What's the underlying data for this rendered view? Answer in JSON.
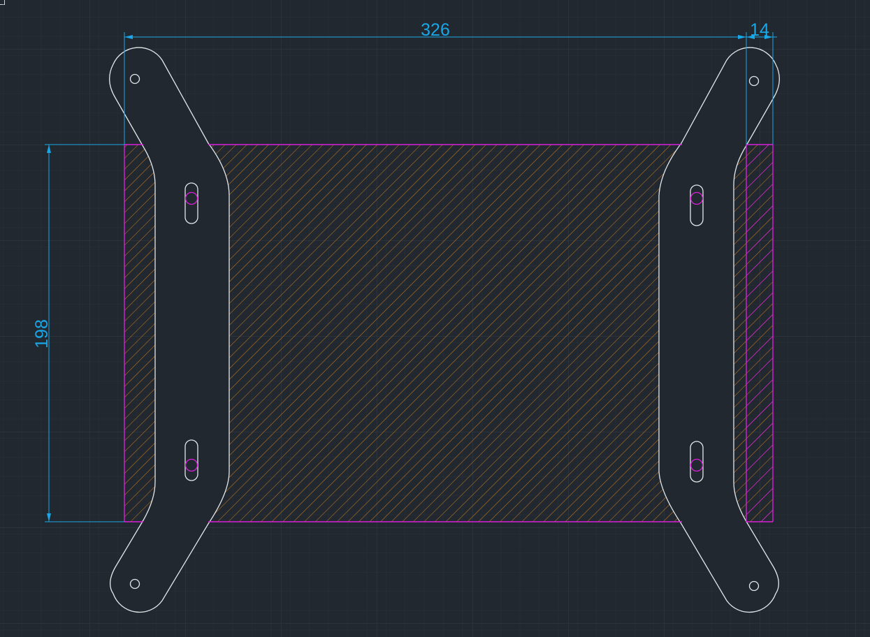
{
  "drawing": {
    "dimensions": {
      "width_label": "326",
      "offset_label": "14",
      "height_label": "198"
    },
    "colors": {
      "background": "#212830",
      "grid_minor": "#2a3139",
      "grid_major": "#333c46",
      "outline": "#e4e7ea",
      "hatch": "#c8761e",
      "region_border": "#d820d8",
      "dimension": "#1aa7e8"
    }
  }
}
